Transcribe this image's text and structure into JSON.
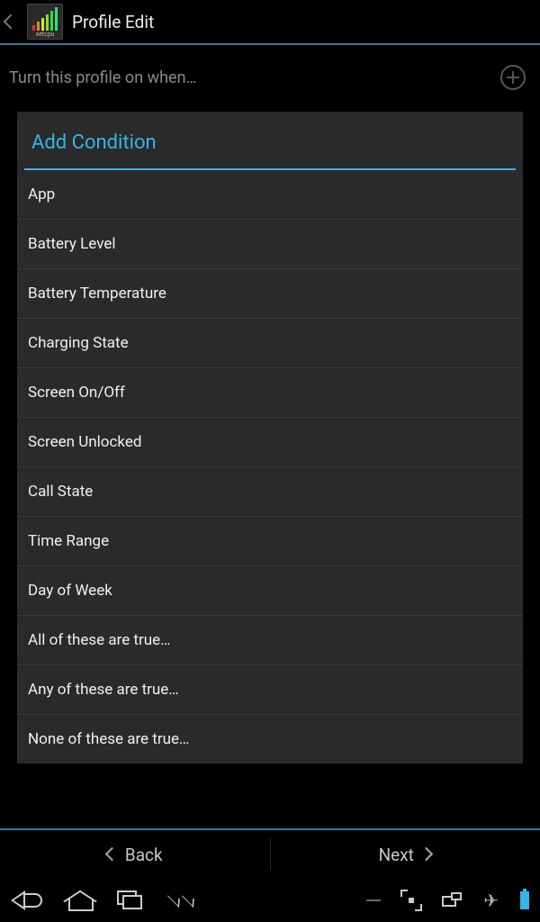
{
  "header": {
    "title": "Profile Edit",
    "app_icon_label": "setcpu"
  },
  "subheader": {
    "prompt": "Turn this profile on when…"
  },
  "dialog": {
    "title": "Add Condition",
    "items": [
      "App",
      "Battery Level",
      "Battery Temperature",
      "Charging State",
      "Screen On/Off",
      "Screen Unlocked",
      "Call State",
      "Time Range",
      "Day of Week",
      "All of these are true…",
      "Any of these are true…",
      "None of these are true…"
    ]
  },
  "footer": {
    "back": "Back",
    "next": "Next"
  },
  "app_icon_bars": [
    {
      "h": 6,
      "c": "#d33"
    },
    {
      "h": 10,
      "c": "#d83"
    },
    {
      "h": 14,
      "c": "#dd3"
    },
    {
      "h": 18,
      "c": "#8d3"
    },
    {
      "h": 22,
      "c": "#3d3"
    },
    {
      "h": 26,
      "c": "#3d8"
    }
  ]
}
